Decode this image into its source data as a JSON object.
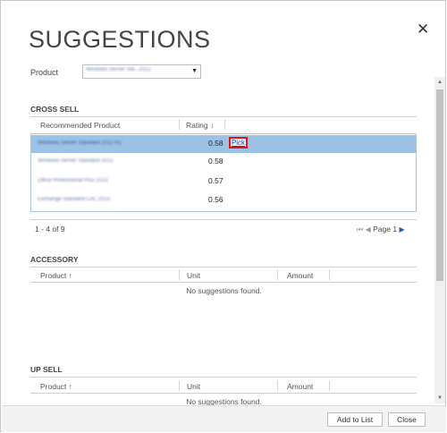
{
  "dialog": {
    "title": "SUGGESTIONS",
    "close_glyph": "✕"
  },
  "product": {
    "label": "Product",
    "selected": "Windows Server Sta...2012",
    "arrow": "▼"
  },
  "cross_sell": {
    "title": "CROSS SELL",
    "columns": [
      "Recommended Product",
      "Rating"
    ],
    "sort_glyph": "↓",
    "rows": [
      {
        "name": "Windows Server Standard 2012 R2",
        "rating": "0.58",
        "selected": true
      },
      {
        "name": "Windows Server Standard 2012",
        "rating": "0.58",
        "selected": false
      },
      {
        "name": "Office Professional Plus 2013",
        "rating": "0.57",
        "selected": false
      },
      {
        "name": "Exchange Standard CAL 2013",
        "rating": "0.56",
        "selected": false
      }
    ],
    "pick_label": "Pick",
    "pager": {
      "count": "1 - 4 of 9",
      "page": "Page 1",
      "first_glyph": "⏮",
      "prev_glyph": "◀",
      "next_glyph": "▶"
    }
  },
  "accessory": {
    "title": "ACCESSORY",
    "columns": [
      "Product ↑",
      "Unit",
      "Amount"
    ],
    "empty": "No suggestions found."
  },
  "up_sell": {
    "title": "UP SELL",
    "columns": [
      "Product ↑",
      "Unit",
      "Amount"
    ],
    "empty": "No suggestions found."
  },
  "scrollbar": {
    "up_glyph": "▲",
    "down_glyph": "▼"
  },
  "footer": {
    "add_to_list": "Add to List",
    "close": "Close"
  }
}
